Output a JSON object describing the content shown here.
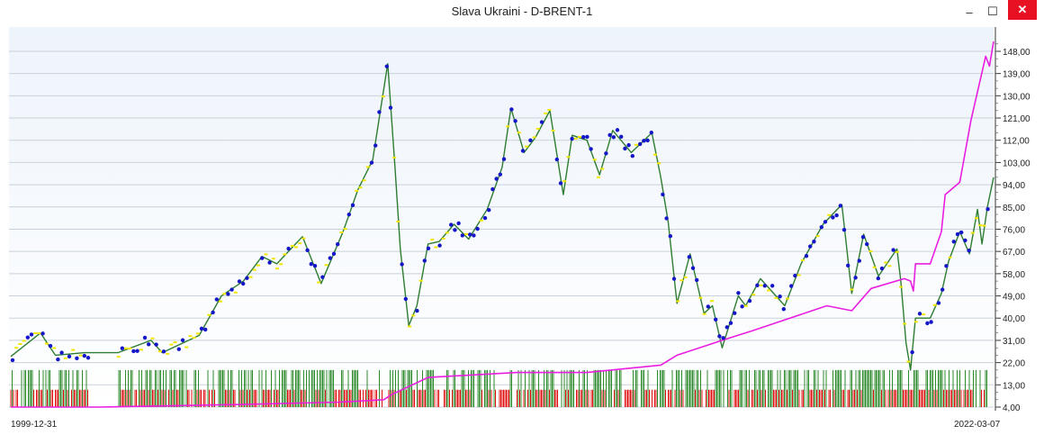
{
  "window": {
    "title": "Slava Ukraini - D-BRENT-1",
    "minimize_glyph": "–",
    "maximize_glyph": "☐",
    "close_glyph": "✕"
  },
  "chart_data": {
    "type": "line",
    "title": "",
    "symbol": "D-BRENT-1",
    "x_start_label": "1999-12-31",
    "x_end_label": "2022-03-07",
    "x_range": [
      "1999-12-31",
      "2022-03-07"
    ],
    "ylim": [
      4,
      152
    ],
    "y_ticks": [
      "148,00",
      "139,00",
      "130,00",
      "121,00",
      "112,00",
      "103,00",
      "94,00",
      "85,00",
      "76,00",
      "67,00",
      "58,00",
      "49,00",
      "40,00",
      "31,00",
      "22,00",
      "13,00",
      "4,00"
    ],
    "grid": true,
    "gap": [
      "2001-10-01",
      "2002-06-01"
    ],
    "series": [
      {
        "role": "price",
        "color": "#2e7d32",
        "x": [
          "1999-12-31",
          "2000-09-01",
          "2001-01-01",
          "2001-09-01",
          "2002-06-01",
          "2003-03-01",
          "2003-06-01",
          "2004-04-01",
          "2004-10-01",
          "2005-04-01",
          "2005-09-01",
          "2006-01-01",
          "2006-08-01",
          "2007-01-01",
          "2007-07-01",
          "2007-11-01",
          "2008-03-01",
          "2008-07-03",
          "2008-09-01",
          "2008-10-15",
          "2008-12-24",
          "2009-03-01",
          "2009-06-01",
          "2009-09-01",
          "2010-01-01",
          "2010-05-01",
          "2010-10-01",
          "2011-02-01",
          "2011-04-15",
          "2011-08-01",
          "2011-11-01",
          "2012-03-01",
          "2012-06-20",
          "2012-09-01",
          "2013-01-01",
          "2013-04-15",
          "2013-08-01",
          "2014-01-01",
          "2014-06-20",
          "2014-09-01",
          "2014-11-01",
          "2015-01-13",
          "2015-05-01",
          "2015-08-24",
          "2015-11-01",
          "2016-01-20",
          "2016-06-01",
          "2016-08-01",
          "2016-12-01",
          "2017-06-20",
          "2017-11-01",
          "2018-05-01",
          "2018-10-03",
          "2018-12-24",
          "2019-04-01",
          "2019-08-01",
          "2019-12-31",
          "2020-02-01",
          "2020-03-15",
          "2020-04-21",
          "2020-06-01",
          "2020-10-01",
          "2021-01-01",
          "2021-03-01",
          "2021-06-01",
          "2021-08-20",
          "2021-10-25",
          "2021-12-01",
          "2022-01-15",
          "2022-03-07"
        ],
        "values": [
          24.5,
          34,
          25,
          26,
          26,
          31,
          26,
          33,
          49,
          55,
          65,
          62,
          73,
          54,
          75,
          92,
          104,
          143,
          101,
          68,
          37,
          45,
          70,
          71,
          78,
          72,
          84,
          101,
          125,
          107,
          113,
          124,
          90,
          114,
          112,
          98,
          116,
          107,
          115,
          97,
          79,
          46,
          66,
          42,
          45,
          28,
          49,
          45,
          56,
          45,
          62,
          78,
          86,
          50,
          74,
          57,
          68,
          55,
          30,
          19,
          40,
          40,
          50,
          63,
          75,
          66,
          84,
          70,
          85,
          97
        ]
      },
      {
        "role": "equity",
        "color": "#e91ee0",
        "x": [
          "1999-12-31",
          "2002-01-01",
          "2005-01-01",
          "2007-06-01",
          "2008-06-01",
          "2008-08-01",
          "2009-06-01",
          "2011-06-01",
          "2013-01-01",
          "2014-09-01",
          "2015-01-13",
          "2016-01-20",
          "2016-10-01",
          "2017-06-01",
          "2018-06-01",
          "2018-12-24",
          "2019-06-01",
          "2020-03-01",
          "2020-04-21",
          "2020-05-15",
          "2020-06-01",
          "2020-10-01",
          "2021-01-01",
          "2021-02-01",
          "2021-06-01",
          "2021-07-01",
          "2021-09-01",
          "2021-11-01",
          "2022-01-01",
          "2022-02-01",
          "2022-03-07"
        ],
        "values": [
          4,
          4,
          5,
          6,
          7,
          9,
          16,
          18,
          18,
          21,
          25,
          31,
          35,
          39,
          45,
          43,
          52,
          56,
          55,
          51,
          62,
          62,
          75,
          90,
          95,
          103,
          120,
          133,
          146,
          142,
          152
        ]
      }
    ],
    "volume": {
      "up_color": "#2e8b2e",
      "down_color": "#e11010",
      "up_top": 19,
      "down_top": 11,
      "bottom": 4
    }
  }
}
